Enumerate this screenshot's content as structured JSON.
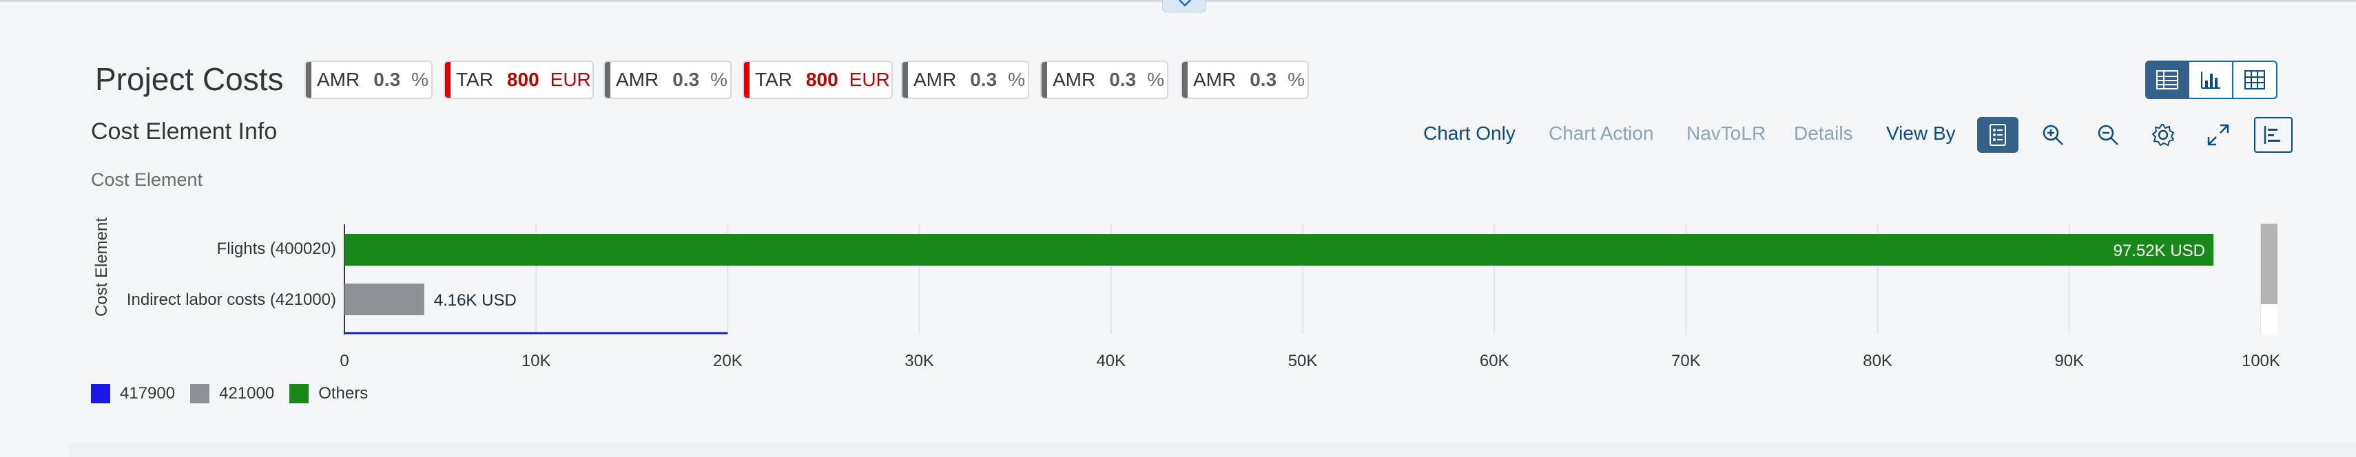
{
  "header": {
    "title": "Project Costs"
  },
  "kpis": [
    {
      "name": "AMR",
      "value": "0.3",
      "unit": "%",
      "status": "neutral"
    },
    {
      "name": "TAR",
      "value": "800",
      "unit": "EUR",
      "status": "negative"
    },
    {
      "name": "AMR",
      "value": "0.3",
      "unit": "%",
      "status": "neutral"
    },
    {
      "name": "TAR",
      "value": "800",
      "unit": "EUR",
      "status": "negative"
    },
    {
      "name": "AMR",
      "value": "0.3",
      "unit": "%",
      "status": "neutral"
    },
    {
      "name": "AMR",
      "value": "0.3",
      "unit": "%",
      "status": "neutral"
    },
    {
      "name": "AMR",
      "value": "0.3",
      "unit": "%",
      "status": "neutral"
    }
  ],
  "view_switch": {
    "buttons": [
      {
        "icon": "chart-table-icon",
        "active": true
      },
      {
        "icon": "bar-chart-icon",
        "active": false
      },
      {
        "icon": "table-grid-icon",
        "active": false
      }
    ]
  },
  "card": {
    "title": "Cost Element Info",
    "subtitle": "Cost Element",
    "toolbar": {
      "chart_only": "Chart Only",
      "chart_action": "Chart Action",
      "nav_to_lr": "NavToLR",
      "details": "Details",
      "view_by": "View By",
      "icons": [
        "legend-icon",
        "zoom-in-icon",
        "zoom-out-icon",
        "settings-icon",
        "fullscreen-icon",
        "chart-type-icon"
      ]
    }
  },
  "colors": {
    "417900": "#1a1ae6",
    "421000": "#8c9196",
    "Others": "#188918",
    "accent": "#346187"
  },
  "chart_data": {
    "type": "bar",
    "orientation": "horizontal",
    "y_axis_title": "Cost Element",
    "categories": [
      "Flights (400020)",
      "Indirect labor costs (421000)"
    ],
    "series": [
      {
        "name": "417900",
        "values": [
          0,
          0
        ]
      },
      {
        "name": "421000",
        "values": [
          0,
          4160
        ]
      },
      {
        "name": "Others",
        "values": [
          97520,
          0
        ]
      }
    ],
    "data_labels": [
      "97.52K USD",
      "4.16K USD"
    ],
    "xlim": [
      0,
      100000
    ],
    "x_ticks": [
      "0",
      "10K",
      "20K",
      "30K",
      "40K",
      "50K",
      "60K",
      "70K",
      "80K",
      "90K",
      "100K"
    ],
    "legend": [
      "417900",
      "421000",
      "Others"
    ],
    "legend_position": "bottom-left",
    "grid": true,
    "scroll_position": 0.2
  }
}
